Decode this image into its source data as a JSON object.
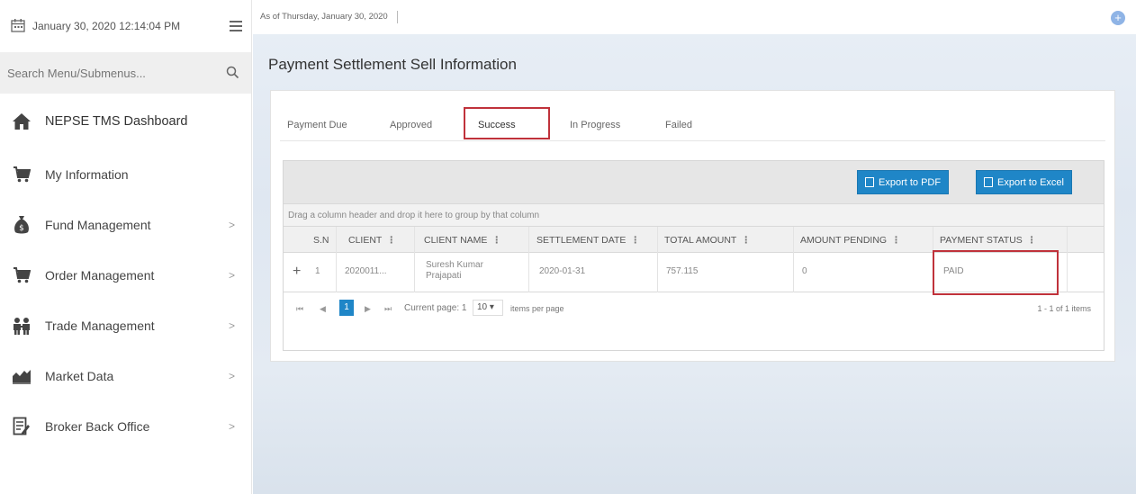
{
  "sidebar": {
    "datetime": "January 30, 2020 12:14:04 PM",
    "search_placeholder": "Search Menu/Submenus...",
    "items": [
      {
        "label": "NEPSE TMS Dashboard",
        "icon": "home-icon",
        "chevron": ""
      },
      {
        "label": "My Information",
        "icon": "cart-icon",
        "chevron": ""
      },
      {
        "label": "Fund Management",
        "icon": "money-bag-icon",
        "chevron": ">"
      },
      {
        "label": "Order Management",
        "icon": "cart-icon",
        "chevron": ">"
      },
      {
        "label": "Trade Management",
        "icon": "people-icon",
        "chevron": ">"
      },
      {
        "label": "Market Data",
        "icon": "chart-icon",
        "chevron": ">"
      },
      {
        "label": "Broker Back Office",
        "icon": "document-edit-icon",
        "chevron": ">"
      }
    ]
  },
  "topbar": {
    "as_of": "As of Thursday, January 30, 2020",
    "plus": "+"
  },
  "page": {
    "title": "Payment Settlement Sell Information"
  },
  "tabs": [
    "Payment Due",
    "Approved",
    "Success",
    "In Progress",
    "Failed"
  ],
  "active_tab": "Success",
  "grid": {
    "export_pdf": "Export to PDF",
    "export_excel": "Export to Excel",
    "group_hint": "Drag a column header and drop it here to group by that column",
    "columns": [
      "S.N",
      "CLIENT",
      "CLIENT NAME",
      "SETTLEMENT DATE",
      "TOTAL AMOUNT",
      "AMOUNT PENDING",
      "PAYMENT STATUS"
    ],
    "kebab": "⋮",
    "rows": [
      {
        "expand": "+",
        "sn": "1",
        "client": "2020011...",
        "client_name_line1": "Suresh Kumar",
        "client_name_line2": "Prajapati",
        "settlement_date": "2020-01-31",
        "total_amount": "757.115",
        "amount_pending": "0",
        "payment_status": "PAID"
      }
    ],
    "pager": {
      "first": "⏮",
      "prev": "◀",
      "current": "1",
      "next": "▶",
      "last": "⏭",
      "current_page_text": "Current page: 1",
      "page_size": "10 ▾",
      "items_per_page": "items per page",
      "summary": "1 - 1 of 1 items"
    }
  },
  "colors": {
    "accent": "#1f86c7",
    "highlight": "#c0323b"
  }
}
